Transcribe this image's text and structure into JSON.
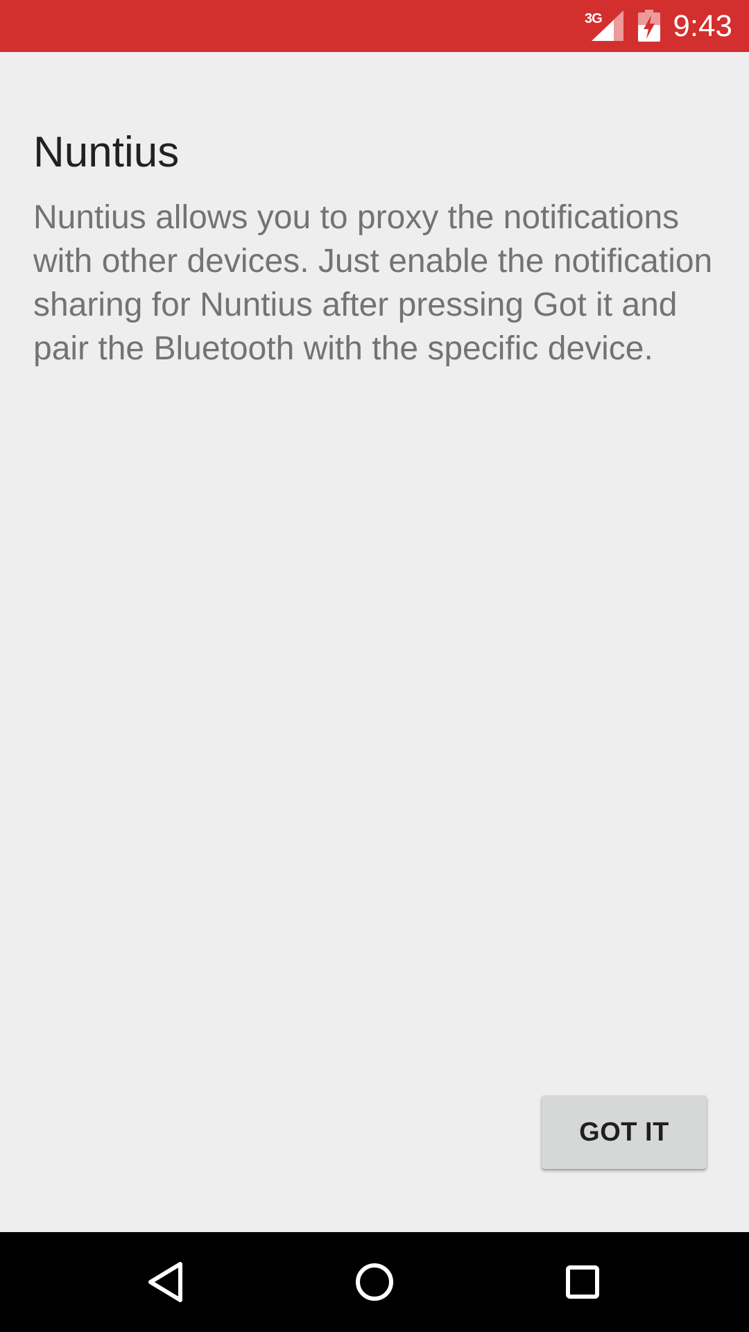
{
  "status_bar": {
    "network_type": "3G",
    "time": "9:43",
    "background_color": "#d32f2f",
    "icons": [
      "signal-icon",
      "battery-charging-icon"
    ]
  },
  "intro": {
    "title": "Nuntius",
    "description": "Nuntius allows you to proxy the notifications with other devices. Just enable the notification sharing for Nuntius after pressing Got it and pair the Bluetooth with the specific device."
  },
  "actions": {
    "got_it_label": "GOT IT"
  },
  "nav_bar": {
    "icons": [
      "back-icon",
      "home-icon",
      "recents-icon"
    ]
  }
}
